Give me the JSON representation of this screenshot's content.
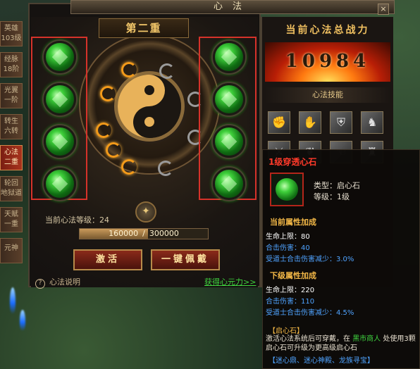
{
  "window": {
    "title": "心法",
    "close": "×"
  },
  "tabs": [
    {
      "label": "英雄\n103级",
      "active": false
    },
    {
      "label": "经脉\n18阶",
      "active": false
    },
    {
      "label": "光翼\n一阶",
      "active": false
    },
    {
      "label": "转生\n六转",
      "active": false
    },
    {
      "label": "心法\n二重",
      "active": true
    },
    {
      "label": "轮回\n地狱道",
      "active": false
    },
    {
      "label": "天赋\n一重",
      "active": false
    },
    {
      "label": "元神",
      "active": false
    }
  ],
  "center": {
    "stage": "第二重",
    "level_label": "当前心法等级：24",
    "xp_current": "160000",
    "xp_sep": "/",
    "xp_total": "300000",
    "xp_fraction": 0.533,
    "activate_btn": "激活",
    "equip_btn": "一键佩戴",
    "help": "心法说明",
    "help_icon": "?",
    "link": "获得心元力>>"
  },
  "right": {
    "power_title": "当前心法总战力",
    "power_value": "10984",
    "skills_title": "心法技能"
  },
  "tooltip": {
    "name": "1级穿透心石",
    "type": "类型：启心石",
    "level": "等级：1级",
    "current_title": "当前属性加成",
    "current_hp": "生命上限：80",
    "current_attack": "合击伤害：40",
    "current_reduce": "受道士合击伤害减少：3.0%",
    "next_title": "下级属性加成",
    "next_hp": "生命上限：220",
    "next_attack": "合击伤害：110",
    "next_reduce": "受道士合击伤害减少：4.5%",
    "sub_title": "【启心石】",
    "desc_a": "激活心法系统后可穿戴，在",
    "desc_shop": "黑市商人",
    "desc_b": "处使用3颗启心石可升级为更高级启心石",
    "footer": "【迷心鼎、迷心神殿、龙族寻宝】"
  },
  "icons": {
    "medal": "medal-icon",
    "skills": [
      "fist-icon",
      "claw-icon",
      "shield-icon",
      "dragon-icon",
      "sword-icon",
      "wings-icon",
      "hand-icon",
      "beast-icon"
    ]
  },
  "colors": {
    "accent": "#d6322a",
    "gem": "#3ecf3a",
    "link": "#3fd43f",
    "stat_blue": "#4fa3ff",
    "title_gold": "#f3b847"
  }
}
